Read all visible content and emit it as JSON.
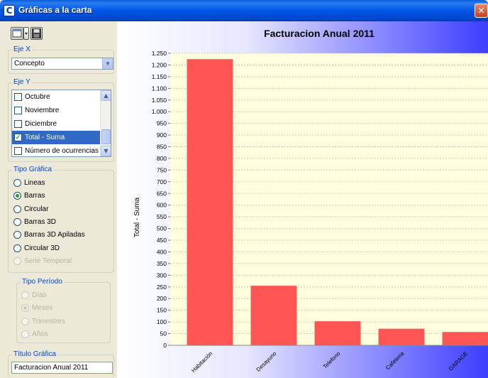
{
  "window": {
    "title": "Gráficas a la carta",
    "app_icon_letter": "C",
    "close_glyph": "✕"
  },
  "toolbar": {
    "buttons": [
      "new-chart-icon",
      "dropdown-arrow-icon",
      "save-icon"
    ]
  },
  "eje_x": {
    "label": "Eje X",
    "selected": "Concepto"
  },
  "eje_y": {
    "label": "Eje Y",
    "items": [
      {
        "label": "Octubre",
        "checked": false,
        "selected": false
      },
      {
        "label": "Noviembre",
        "checked": false,
        "selected": false
      },
      {
        "label": "Diciembre",
        "checked": false,
        "selected": false
      },
      {
        "label": "Total - Suma",
        "checked": true,
        "selected": true
      },
      {
        "label": "Número de ocurrencias",
        "checked": false,
        "selected": false
      }
    ]
  },
  "tipo_grafica": {
    "label": "Tipo Gráfica",
    "options": [
      {
        "label": "Lineas",
        "selected": false,
        "enabled": true
      },
      {
        "label": "Barras",
        "selected": true,
        "enabled": true
      },
      {
        "label": "Circular",
        "selected": false,
        "enabled": true
      },
      {
        "label": "Barras 3D",
        "selected": false,
        "enabled": true
      },
      {
        "label": "Barras 3D Apiladas",
        "selected": false,
        "enabled": true
      },
      {
        "label": "Circular 3D",
        "selected": false,
        "enabled": true
      },
      {
        "label": "Serie Temporal",
        "selected": false,
        "enabled": false
      }
    ]
  },
  "tipo_periodo": {
    "label": "Tipo Período",
    "options": [
      {
        "label": "Días",
        "selected": false,
        "enabled": false
      },
      {
        "label": "Meses",
        "selected": true,
        "enabled": false
      },
      {
        "label": "Trimestres",
        "selected": false,
        "enabled": false
      },
      {
        "label": "Años",
        "selected": false,
        "enabled": false
      }
    ]
  },
  "titulo_grafica": {
    "label": "Título Gráfica",
    "value": "Facturacion Anual 2011"
  },
  "colors": {
    "bar": "#ff5555",
    "plot_background": "#ffffde",
    "gradient_light": "#ffffff",
    "gradient_blue": "#3d3dff",
    "group_label": "#0046d5",
    "selection": "#316ac5"
  },
  "chart_data": {
    "type": "bar",
    "title": "Facturacion Anual 2011",
    "xlabel": "",
    "ylabel": "Total - Suma",
    "categories": [
      "Habitación",
      "Desayuno",
      "Telefono",
      "Cafeteria",
      "GARAGE"
    ],
    "values": [
      1225,
      255,
      103,
      71,
      57
    ],
    "ylim": [
      0,
      1250
    ],
    "yticks": [
      0,
      50,
      100,
      150,
      200,
      250,
      300,
      350,
      400,
      450,
      500,
      550,
      600,
      650,
      700,
      750,
      800,
      850,
      900,
      950,
      1000,
      1050,
      1100,
      1150,
      1200,
      1250
    ],
    "ytick_labels": [
      "0",
      "50",
      "100",
      "150",
      "200",
      "250",
      "300",
      "350",
      "400",
      "450",
      "500",
      "550",
      "600",
      "650",
      "700",
      "750",
      "800",
      "850",
      "900",
      "950",
      "1.000",
      "1.050",
      "1.100",
      "1.150",
      "1.200",
      "1.250"
    ],
    "grid": true,
    "legend": "none"
  }
}
